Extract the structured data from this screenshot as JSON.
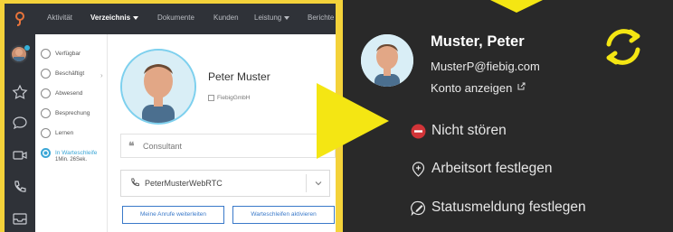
{
  "app": {
    "nav": [
      {
        "label": "Aktivität",
        "bold": false,
        "caret": false
      },
      {
        "label": "Verzeichnis",
        "bold": true,
        "caret": true
      },
      {
        "label": "Dokumente",
        "bold": false,
        "caret": false
      },
      {
        "label": "Kunden",
        "bold": false,
        "caret": false
      },
      {
        "label": "Leistung",
        "bold": false,
        "caret": true
      },
      {
        "label": "Berichte",
        "bold": false,
        "caret": false
      }
    ],
    "rail_icons": [
      "star-icon",
      "chat-bubble-icon",
      "video-icon",
      "phone-icon",
      "inbox-icon"
    ],
    "statuses": [
      {
        "label": "Verfügbar",
        "active": false
      },
      {
        "label": "Beschäftigt",
        "active": false
      },
      {
        "label": "Abwesend",
        "active": false
      },
      {
        "label": "Besprechung",
        "active": false
      },
      {
        "label": "Lernen",
        "active": false
      },
      {
        "label": "In Warteschleife",
        "active": true
      }
    ],
    "queue_timer": "1Min. 26Sek.",
    "profile": {
      "name": "Peter Muster",
      "company": "FiebigGmbH",
      "role": "Consultant",
      "phone_device": "PeterMusterWebRTC"
    },
    "buttons": {
      "forward": "Meine Anrufe weiterleiten",
      "activate_queue": "Warteschleifen aktivieren"
    }
  },
  "colors": {
    "background": "#f4d23a",
    "nav_bg": "#2f3238",
    "accent_blue": "#3a79c9",
    "active_cyan": "#3aa6d6",
    "dark_panel": "#292929",
    "dnd_red": "#d13438",
    "arrow_yellow": "#f4e613"
  },
  "teams": {
    "name": "Muster, Peter",
    "email": "MusterP@fiebig.com",
    "account_link": "Konto anzeigen",
    "menu": [
      {
        "label": "Nicht stören",
        "icon": "do-not-disturb-icon"
      },
      {
        "label": "Arbeitsort festlegen",
        "icon": "location-plus-icon"
      },
      {
        "label": "Statusmeldung festlegen",
        "icon": "status-message-icon"
      }
    ]
  }
}
